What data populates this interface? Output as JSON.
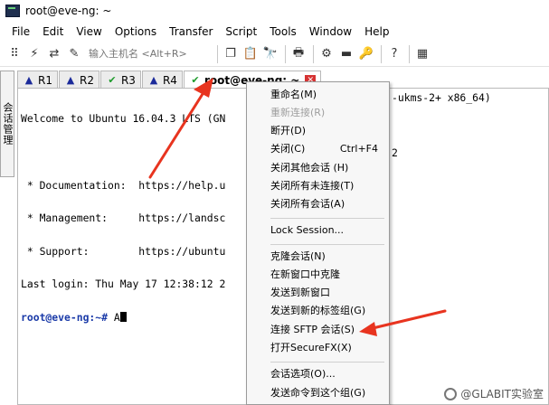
{
  "window": {
    "title": "root@eve-ng: ~"
  },
  "menubar": [
    "File",
    "Edit",
    "View",
    "Options",
    "Transfer",
    "Script",
    "Tools",
    "Window",
    "Help"
  ],
  "toolbar": {
    "host_placeholder": "输入主机名 <Alt+R>"
  },
  "side_tab": {
    "label": "会话管理"
  },
  "tabs": [
    {
      "label": "R1",
      "status": "warning"
    },
    {
      "label": "R2",
      "status": "warning"
    },
    {
      "label": "R3",
      "status": "connected"
    },
    {
      "label": "R4",
      "status": "warning"
    },
    {
      "label": "root@eve-ng: ~",
      "status": "connected",
      "active": true
    }
  ],
  "terminal": {
    "lines": [
      "Welcome to Ubuntu 16.04.3 LTS (GN",
      "",
      " * Documentation:  https://help.u",
      " * Management:     https://landsc",
      " * Support:        https://ubuntu",
      "Last login: Thu May 17 12:38:12 2"
    ],
    "right_fragment": "-ukms-2+ x86_64)",
    "right_fragment_2": "2",
    "prompt": "root@eve-ng:~#",
    "input": " A"
  },
  "context_menu": {
    "items": [
      {
        "label": "重命名(M)"
      },
      {
        "label": "重新连接(R)",
        "disabled": true
      },
      {
        "label": "断开(D)"
      },
      {
        "label": "关闭(C)",
        "shortcut": "Ctrl+F4"
      },
      {
        "label": "关闭其他会话 (H)"
      },
      {
        "label": "关闭所有未连接(T)"
      },
      {
        "label": "关闭所有会话(A)"
      },
      {
        "label": "Lock Session..."
      },
      {
        "label": "克隆会话(N)"
      },
      {
        "label": "在新窗口中克隆"
      },
      {
        "label": "发送到新窗口"
      },
      {
        "label": "发送到新的标签组(G)"
      },
      {
        "label": "连接 SFTP 会话(S)"
      },
      {
        "label": "打开SecureFX(X)"
      },
      {
        "label": "会话选项(O)..."
      },
      {
        "label": "发送命令到这个组(G)"
      }
    ]
  },
  "watermark": {
    "text": "@GLABIT实验室"
  },
  "colors": {
    "accent_arrow": "#e8341f",
    "prompt": "#1a3aa8",
    "tab_close": "#d63333"
  }
}
